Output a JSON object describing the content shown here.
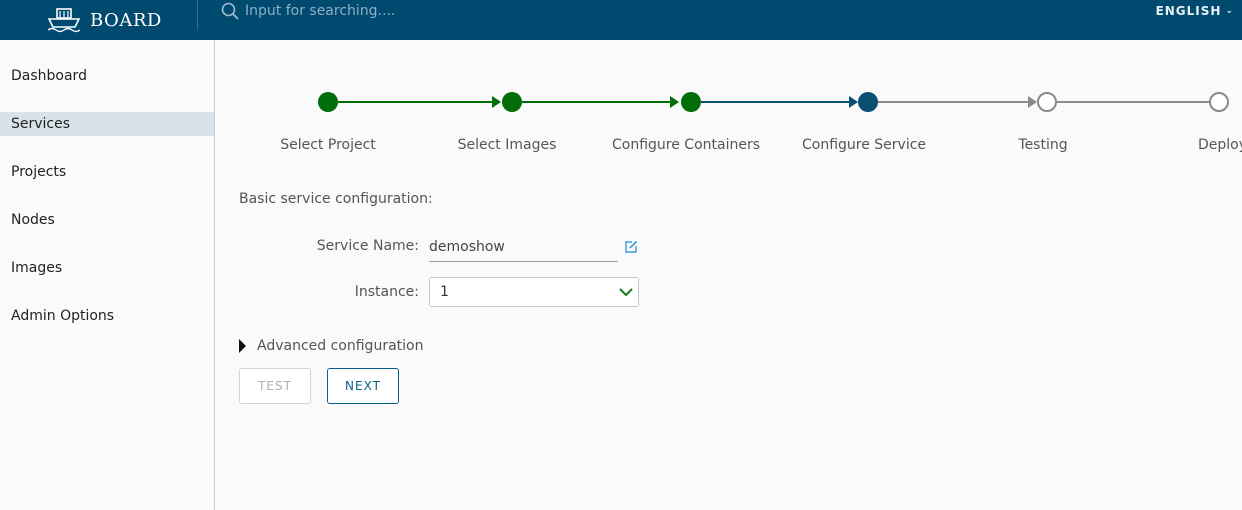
{
  "header": {
    "brand": "BOARD",
    "search_placeholder": "Input for searching....",
    "language": "ENGLISH"
  },
  "sidebar": {
    "items": [
      {
        "label": "Dashboard",
        "active": false
      },
      {
        "label": "Services",
        "active": true
      },
      {
        "label": "Projects",
        "active": false
      },
      {
        "label": "Nodes",
        "active": false
      },
      {
        "label": "Images",
        "active": false
      },
      {
        "label": "Admin Options",
        "active": false
      }
    ]
  },
  "wizard": {
    "steps": [
      {
        "label": "Select Project",
        "state": "done"
      },
      {
        "label": "Select Images",
        "state": "done"
      },
      {
        "label": "Configure Containers",
        "state": "done"
      },
      {
        "label": "Configure Service",
        "state": "current"
      },
      {
        "label": "Testing",
        "state": "todo"
      },
      {
        "label": "Deploy",
        "state": "todo"
      }
    ],
    "colors": {
      "done": "#006d09",
      "current": "#0b4f72",
      "todo": "#8a8a8a"
    }
  },
  "form": {
    "section_title": "Basic service configuration:",
    "service_name_label": "Service Name:",
    "service_name_value": "demoshow",
    "instance_label": "Instance:",
    "instance_value": "1",
    "advanced_label": "Advanced configuration"
  },
  "buttons": {
    "test": "TEST",
    "next": "NEXT"
  }
}
